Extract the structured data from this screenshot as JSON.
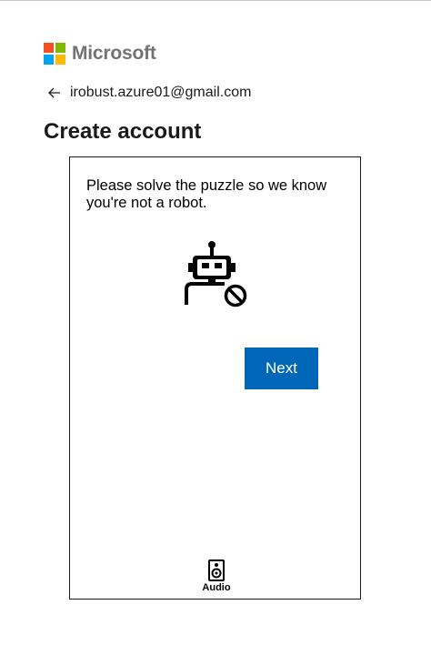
{
  "brand": {
    "name": "Microsoft",
    "colors": {
      "red": "#f25022",
      "green": "#7fba00",
      "blue": "#00a4ef",
      "yellow": "#ffb900"
    }
  },
  "header": {
    "back_icon": "arrow-left-icon",
    "email": "irobust.azure01@gmail.com",
    "title": "Create account"
  },
  "puzzle": {
    "prompt": "Please solve the puzzle so we know you're not a robot.",
    "icon": "robot-blocked-icon",
    "next_label": "Next",
    "audio_icon": "speaker-icon",
    "audio_label": "Audio"
  },
  "theme": {
    "accent": "#0067b8"
  }
}
